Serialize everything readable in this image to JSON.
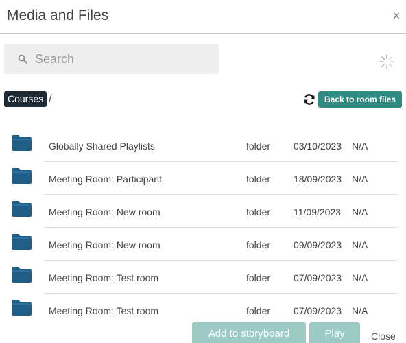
{
  "dialog": {
    "title": "Media and Files",
    "close_glyph": "×"
  },
  "search": {
    "placeholder": "Search",
    "value": "",
    "icon": "search-icon"
  },
  "loading_icon": "spinner-icon",
  "breadcrumb": {
    "items": [
      "Courses"
    ],
    "separator": "/"
  },
  "toolbar": {
    "refresh_icon": "refresh-icon",
    "back_label": "Back to room files"
  },
  "colors": {
    "accent": "#2f8a82",
    "accent_disabled": "#9ccac5",
    "folder": "#1f5f87",
    "breadcrumb_bg": "#1e2a33"
  },
  "files": [
    {
      "name": "Globally Shared Playlists",
      "type": "folder",
      "date": "03/10/2023",
      "size": "N/A",
      "icon": "folder-icon"
    },
    {
      "name": "Meeting Room: Participant",
      "type": "folder",
      "date": "18/09/2023",
      "size": "N/A",
      "icon": "folder-icon"
    },
    {
      "name": "Meeting Room: New room",
      "type": "folder",
      "date": "11/09/2023",
      "size": "N/A",
      "icon": "folder-icon"
    },
    {
      "name": "Meeting Room: New room",
      "type": "folder",
      "date": "09/09/2023",
      "size": "N/A",
      "icon": "folder-icon"
    },
    {
      "name": "Meeting Room: Test room",
      "type": "folder",
      "date": "07/09/2023",
      "size": "N/A",
      "icon": "folder-icon"
    },
    {
      "name": "Meeting Room: Test room",
      "type": "folder",
      "date": "07/09/2023",
      "size": "N/A",
      "icon": "folder-icon"
    }
  ],
  "footer": {
    "add_label": "Add to storyboard",
    "play_label": "Play",
    "close_label": "Close"
  }
}
